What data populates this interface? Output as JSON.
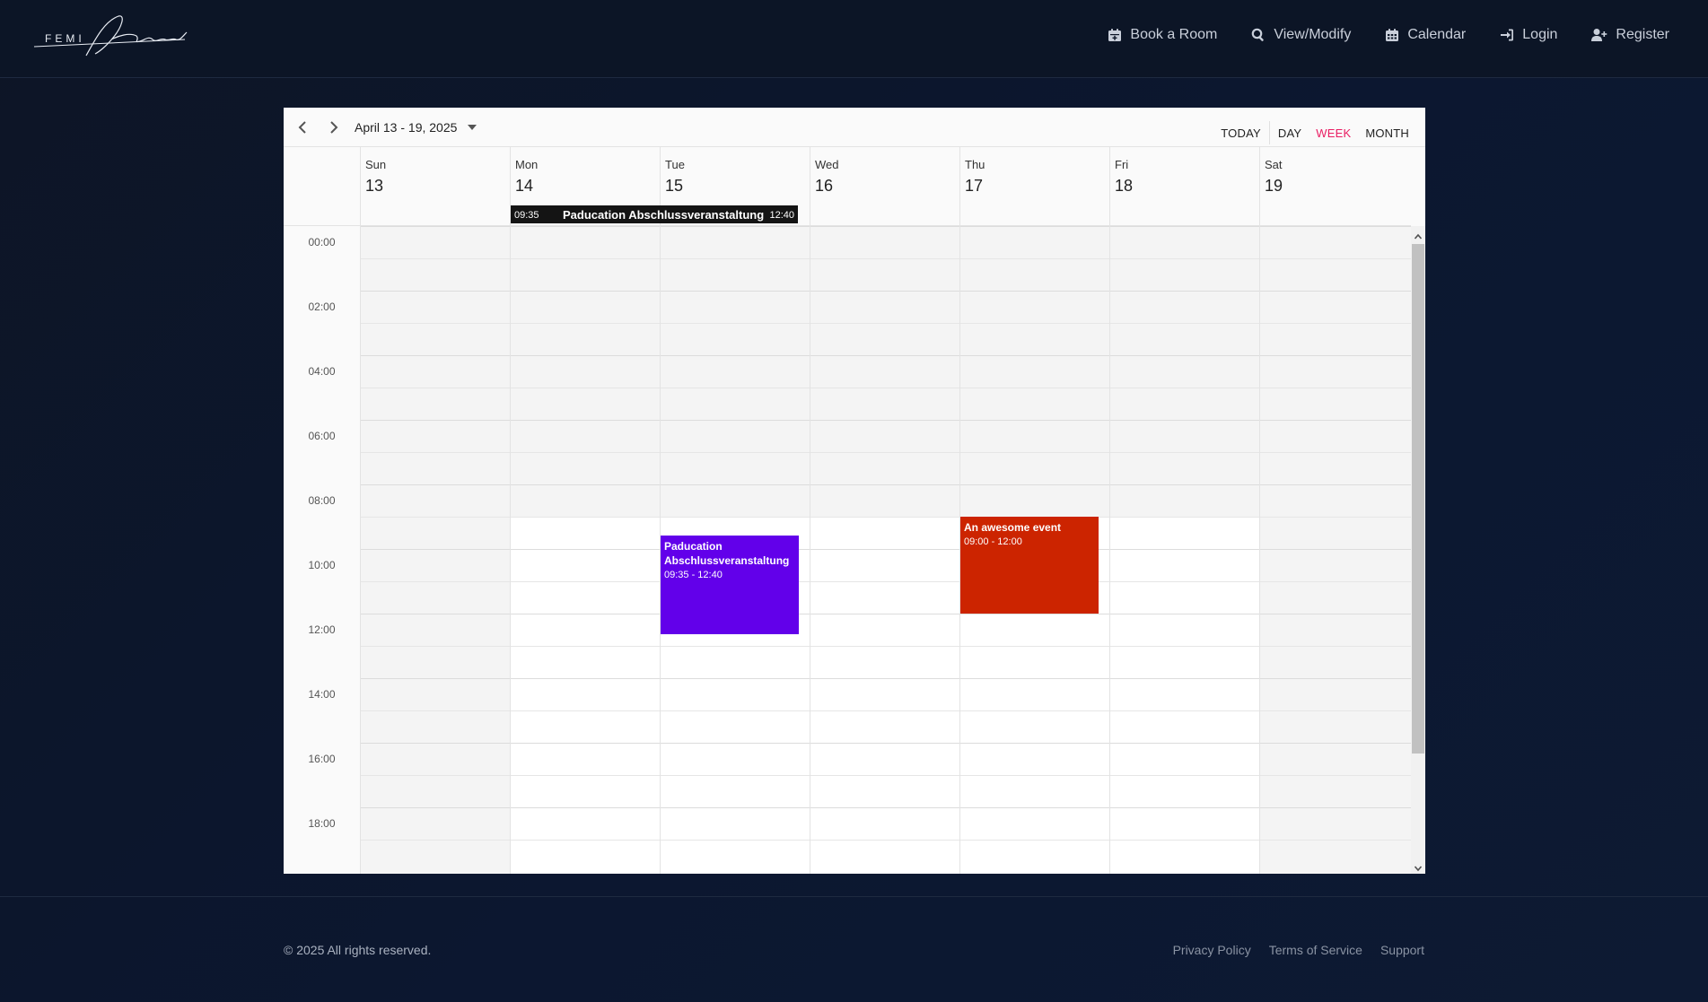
{
  "header": {
    "logo_text": "FEMI",
    "nav": [
      {
        "label": "Book a Room",
        "icon": "calendar-plus-icon"
      },
      {
        "label": "View/Modify",
        "icon": "search-icon"
      },
      {
        "label": "Calendar",
        "icon": "calendar-icon"
      },
      {
        "label": "Login",
        "icon": "login-icon"
      },
      {
        "label": "Register",
        "icon": "user-plus-icon"
      }
    ]
  },
  "calendar": {
    "range": "April 13 - 19, 2025",
    "views": {
      "today": "TODAY",
      "day": "DAY",
      "week": "WEEK",
      "month": "MONTH"
    },
    "active_view": "WEEK",
    "days": [
      {
        "name": "Sun",
        "num": "13"
      },
      {
        "name": "Mon",
        "num": "14"
      },
      {
        "name": "Tue",
        "num": "15"
      },
      {
        "name": "Wed",
        "num": "16"
      },
      {
        "name": "Thu",
        "num": "17"
      },
      {
        "name": "Fri",
        "num": "18"
      },
      {
        "name": "Sat",
        "num": "19"
      }
    ],
    "times": [
      "00:00",
      "02:00",
      "04:00",
      "06:00",
      "08:00",
      "10:00",
      "12:00",
      "14:00",
      "16:00",
      "18:00"
    ],
    "allday_event": {
      "start": "09:35",
      "title": "Paducation Abschlussveranstaltung",
      "end": "12:40"
    },
    "events": [
      {
        "title": "Paducation Abschlussveranstaltung",
        "time": "09:35 - 12:40",
        "color": "#6200ea"
      },
      {
        "title": "An awesome event",
        "time": "09:00 - 12:00",
        "color": "#cc2400"
      }
    ]
  },
  "footer": {
    "copyright": "© 2025 All rights reserved.",
    "links": [
      "Privacy Policy",
      "Terms of Service",
      "Support"
    ]
  }
}
